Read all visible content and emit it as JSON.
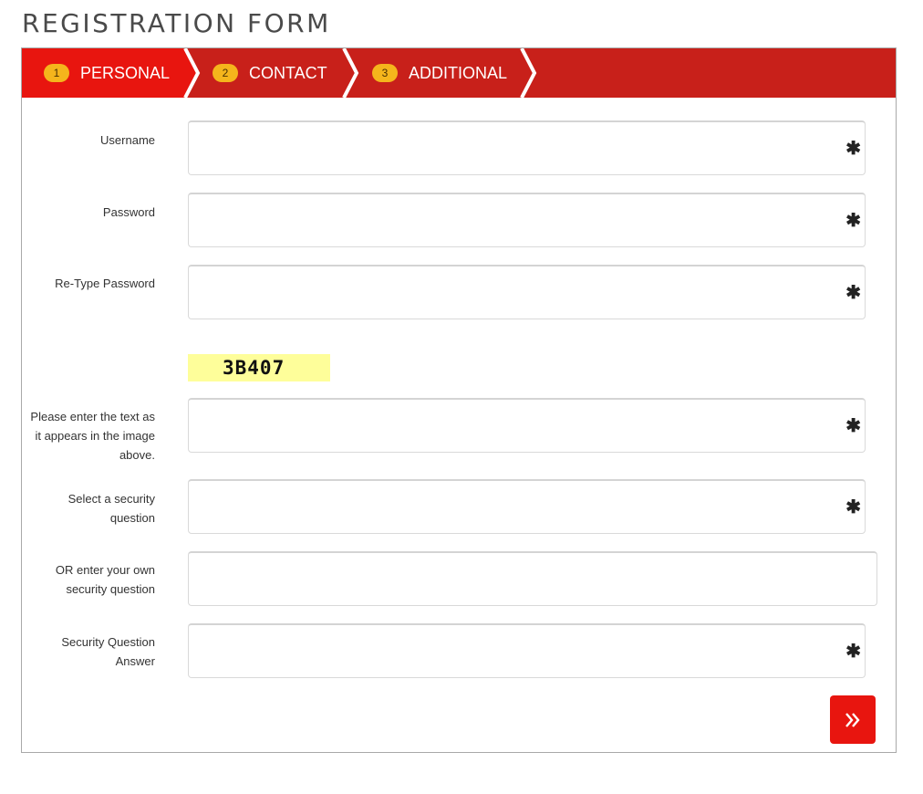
{
  "page": {
    "title": "REGISTRATION FORM"
  },
  "steps": [
    {
      "num": "1",
      "label": "PERSONAL",
      "active": true
    },
    {
      "num": "2",
      "label": "CONTACT",
      "active": false
    },
    {
      "num": "3",
      "label": "ADDITIONAL",
      "active": false
    }
  ],
  "fields": {
    "username": {
      "label": "Username",
      "value": "",
      "required_mark": "✱"
    },
    "password": {
      "label": "Password",
      "value": "",
      "required_mark": "✱"
    },
    "retype_password": {
      "label": "Re-Type Password",
      "value": "",
      "required_mark": "✱"
    },
    "captcha_text": {
      "label": "Please enter the text as it appears in the image above.",
      "value": "",
      "required_mark": "✱"
    },
    "security_question": {
      "label": "Select a security question",
      "value": "",
      "required_mark": "✱"
    },
    "own_question": {
      "label": "OR enter your own security question",
      "value": ""
    },
    "security_answer": {
      "label": "Security Question Answer",
      "value": "",
      "required_mark": "✱"
    }
  },
  "captcha": {
    "text": "3B407"
  },
  "colors": {
    "step_bar": "#c8201a",
    "step_active": "#e8150f",
    "step_badge": "#f5b51c",
    "next_button": "#e8150f",
    "captcha_bg": "#fefe9a"
  },
  "icons": {
    "next": "double-chevron-right-icon",
    "required": "asterisk-icon"
  }
}
